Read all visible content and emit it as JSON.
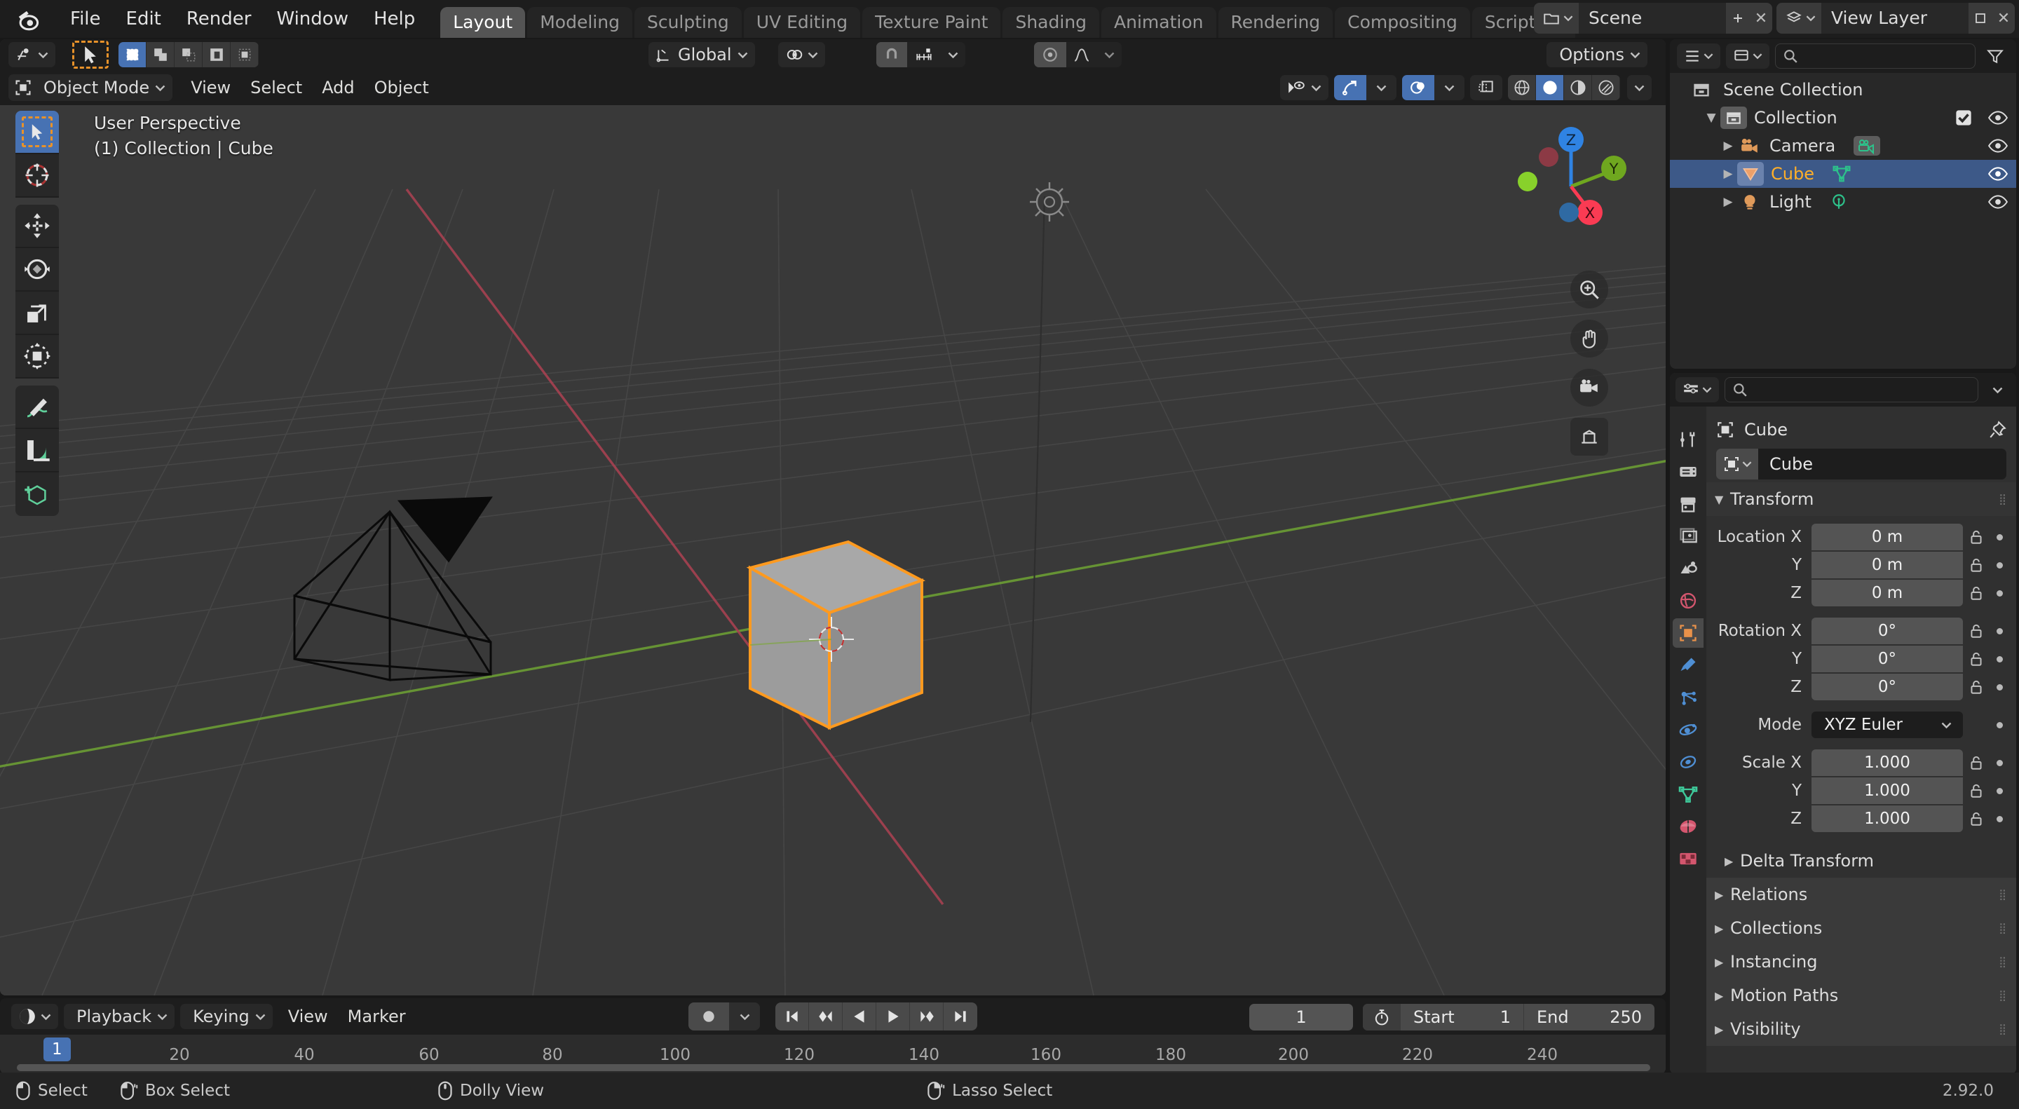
{
  "app": {
    "name": "Blender",
    "version": "2.92.0",
    "logo_icon": "blender-logo-icon"
  },
  "topbar": {
    "menus": [
      "File",
      "Edit",
      "Render",
      "Window",
      "Help"
    ],
    "workspaces": [
      {
        "label": "Layout",
        "active": true
      },
      {
        "label": "Modeling",
        "active": false
      },
      {
        "label": "Sculpting",
        "active": false
      },
      {
        "label": "UV Editing",
        "active": false
      },
      {
        "label": "Texture Paint",
        "active": false
      },
      {
        "label": "Shading",
        "active": false
      },
      {
        "label": "Animation",
        "active": false
      },
      {
        "label": "Rendering",
        "active": false
      },
      {
        "label": "Compositing",
        "active": false
      },
      {
        "label": "Scripting",
        "active": false
      }
    ],
    "add_workspace_label": "+",
    "scene": {
      "icon": "scene-icon",
      "name": "Scene",
      "new_icon": "new-scene-icon",
      "remove_icon": "close-icon"
    },
    "view_layer": {
      "icon": "view-layer-icon",
      "name": "View Layer",
      "new_icon": "new-layer-icon",
      "remove_icon": "close-icon"
    }
  },
  "viewport": {
    "header": {
      "editor_type_icon": "editor-type-3dview-icon",
      "cursor_tool_icon": "tweak-cursor-icon",
      "select_modes": [
        "set-new-selection",
        "extend-selection",
        "subtract-selection",
        "invert-selection",
        "intersect-selection"
      ],
      "transform_orientation": {
        "icon": "orientation-icon",
        "label": "Global"
      },
      "pivot_icon": "pivot-point-icon",
      "snap_icon": "magnet-icon",
      "snap_target_icon": "snap-increment-icon",
      "proportional_icon": "proportional-edit-icon",
      "falloff_icon": "smooth-falloff-icon",
      "options_label": "Options"
    },
    "header2": {
      "mode": "Object Mode",
      "mode_icon": "object-mode-icon",
      "menus": [
        "View",
        "Select",
        "Add",
        "Object"
      ],
      "visibility_icon": "visibility-eye-icon",
      "gizmo_icon": "gizmo-icon",
      "overlays_icon": "overlays-icon",
      "xray_icon": "xray-icon",
      "shading_modes": [
        "wireframe",
        "solid",
        "material-preview",
        "rendered"
      ],
      "active_shading": "solid"
    },
    "overlay": {
      "perspective": "User Perspective",
      "object_info": "(1) Collection | Cube"
    },
    "toolbar": [
      {
        "icon": "select-box-tool-icon",
        "active": true
      },
      {
        "icon": "cursor-tool-icon",
        "active": false
      },
      {
        "icon": "move-tool-icon",
        "active": false
      },
      {
        "icon": "rotate-tool-icon",
        "active": false
      },
      {
        "icon": "scale-tool-icon",
        "active": false
      },
      {
        "icon": "transform-tool-icon",
        "active": false
      },
      {
        "icon": "annotate-tool-icon",
        "active": false
      },
      {
        "icon": "measure-tool-icon",
        "active": false
      },
      {
        "icon": "add-cube-tool-icon",
        "active": false
      }
    ],
    "gizmo": {
      "axes": [
        {
          "label": "Z",
          "color": "#2f83e3"
        },
        {
          "label": "Y",
          "color": "#6fa71f"
        },
        {
          "label": "X",
          "color": "#fa3b53"
        }
      ]
    },
    "nav_buttons": [
      "zoom-icon",
      "pan-hand-icon",
      "camera-view-icon",
      "toggle-ortho-icon"
    ],
    "scene_objects": [
      {
        "name": "Cube",
        "selected": true
      },
      {
        "name": "Camera",
        "selected": false
      },
      {
        "name": "Light",
        "selected": false
      }
    ]
  },
  "timeline": {
    "editor_icon": "timeline-editor-icon",
    "menus": [
      {
        "label": "Playback",
        "has_arrow": true
      },
      {
        "label": "Keying",
        "has_arrow": true
      },
      {
        "label": "View",
        "has_arrow": false
      },
      {
        "label": "Marker",
        "has_arrow": false
      }
    ],
    "record_icon": "auto-keying-record-icon",
    "transport": [
      "jump-to-start-icon",
      "prev-keyframe-icon",
      "play-reverse-icon",
      "play-icon",
      "next-keyframe-icon",
      "jump-to-end-icon"
    ],
    "current_frame": "1",
    "timer_icon": "frame-range-timer-icon",
    "start_label": "Start",
    "start_value": "1",
    "end_label": "End",
    "end_value": "250",
    "ticks": [
      "20",
      "40",
      "60",
      "80",
      "100",
      "120",
      "140",
      "160",
      "180",
      "200",
      "220",
      "240"
    ],
    "playhead_label": "1"
  },
  "outliner": {
    "display_mode_icon": "outliner-display-mode-icon",
    "filter_icon": "filter-icon",
    "search_icon": "search-icon",
    "search_placeholder": "",
    "rows": [
      {
        "label": "Scene Collection",
        "icon": "scene-collection-icon",
        "indent": 0,
        "selected": false,
        "has_disclosure": false,
        "has_checkbox": false,
        "has_eye": false,
        "data_icon": null
      },
      {
        "label": "Collection",
        "icon": "collection-icon",
        "indent": 1,
        "selected": false,
        "has_disclosure": true,
        "expanded": true,
        "has_checkbox": true,
        "has_eye": true,
        "data_icon": null
      },
      {
        "label": "Camera",
        "icon": "camera-object-icon",
        "indent": 2,
        "selected": false,
        "has_disclosure": true,
        "expanded": false,
        "has_checkbox": false,
        "has_eye": true,
        "data_icon": "camera-data-icon"
      },
      {
        "label": "Cube",
        "icon": "mesh-object-icon",
        "indent": 2,
        "selected": true,
        "has_disclosure": true,
        "expanded": false,
        "has_checkbox": false,
        "has_eye": true,
        "data_icon": "mesh-data-icon"
      },
      {
        "label": "Light",
        "icon": "light-object-icon",
        "indent": 2,
        "selected": false,
        "has_disclosure": true,
        "expanded": false,
        "has_checkbox": false,
        "has_eye": true,
        "data_icon": "light-data-icon"
      }
    ]
  },
  "properties": {
    "editor_icon": "properties-editor-icon",
    "search_icon": "search-icon",
    "search_placeholder": "",
    "options_icon": "chevron-down-icon",
    "tabs": [
      {
        "icon": "tool-tab-icon",
        "name": "Tool",
        "active": false,
        "color": "#c8c8c8"
      },
      {
        "icon": "render-tab-icon",
        "name": "Render",
        "active": false,
        "color": "#c8c8c8"
      },
      {
        "icon": "output-tab-icon",
        "name": "Output",
        "active": false,
        "color": "#c8c8c8"
      },
      {
        "icon": "view-layer-tab-icon",
        "name": "View Layer",
        "active": false,
        "color": "#c8c8c8"
      },
      {
        "icon": "scene-tab-icon",
        "name": "Scene",
        "active": false,
        "color": "#c8c8c8"
      },
      {
        "icon": "world-tab-icon",
        "name": "World",
        "active": false,
        "color": "#d4566e"
      },
      {
        "icon": "object-tab-icon",
        "name": "Object",
        "active": true,
        "color": "#e8914a"
      },
      {
        "icon": "modifier-tab-icon",
        "name": "Modifiers",
        "active": false,
        "color": "#4f8fd4"
      },
      {
        "icon": "particles-tab-icon",
        "name": "Particles",
        "active": false,
        "color": "#4f8fd4"
      },
      {
        "icon": "physics-tab-icon",
        "name": "Physics",
        "active": false,
        "color": "#4f8fd4"
      },
      {
        "icon": "constraints-tab-icon",
        "name": "Object Constraints",
        "active": false,
        "color": "#4f8fd4"
      },
      {
        "icon": "data-tab-icon",
        "name": "Object Data",
        "active": false,
        "color": "#3ec99a"
      },
      {
        "icon": "material-tab-icon",
        "name": "Material",
        "active": false,
        "color": "#d4566e"
      },
      {
        "icon": "texture-tab-icon",
        "name": "Texture",
        "active": false,
        "color": "#d4566e"
      }
    ],
    "breadcrumb": {
      "icon": "object-icon",
      "label": "Cube",
      "pin_icon": "pin-icon"
    },
    "id_block": {
      "icon": "object-icon",
      "dropdown_icon": "chevron-down-icon",
      "name": "Cube"
    },
    "panels": [
      {
        "label": "Transform",
        "expanded": true,
        "has_grip": true
      },
      {
        "label": "Delta Transform",
        "expanded": false,
        "sub": true,
        "has_grip": false
      },
      {
        "label": "Relations",
        "expanded": false,
        "has_grip": true
      },
      {
        "label": "Collections",
        "expanded": false,
        "has_grip": true
      },
      {
        "label": "Instancing",
        "expanded": false,
        "has_grip": true
      },
      {
        "label": "Motion Paths",
        "expanded": false,
        "has_grip": true
      },
      {
        "label": "Visibility",
        "expanded": false,
        "has_grip": true
      }
    ],
    "transform": {
      "location": {
        "label": "Location X",
        "sub_labels": [
          "Y",
          "Z"
        ],
        "values": [
          "0 m",
          "0 m",
          "0 m"
        ]
      },
      "rotation": {
        "label": "Rotation X",
        "sub_labels": [
          "Y",
          "Z"
        ],
        "values": [
          "0°",
          "0°",
          "0°"
        ]
      },
      "mode": {
        "label": "Mode",
        "value": "XYZ Euler"
      },
      "scale": {
        "label": "Scale X",
        "sub_labels": [
          "Y",
          "Z"
        ],
        "values": [
          "1.000",
          "1.000",
          "1.000"
        ]
      }
    }
  },
  "status_bar": {
    "items": [
      {
        "icon": "mouse-left-icon",
        "label": "Select"
      },
      {
        "icon": "mouse-left-drag-icon",
        "label": "Box Select"
      },
      {
        "icon": "mouse-middle-icon",
        "label": "Dolly View"
      },
      {
        "icon": "mouse-right-drag-icon",
        "label": "Lasso Select"
      }
    ],
    "version": "2.92.0"
  },
  "colors": {
    "accent_blue": "#4772b3",
    "selected_orange": "#ffaf29",
    "outliner_select": "#3d5988",
    "bg_dark": "#1d1d1d",
    "bg_panel": "#303030",
    "viewport_bg": "#393939"
  }
}
